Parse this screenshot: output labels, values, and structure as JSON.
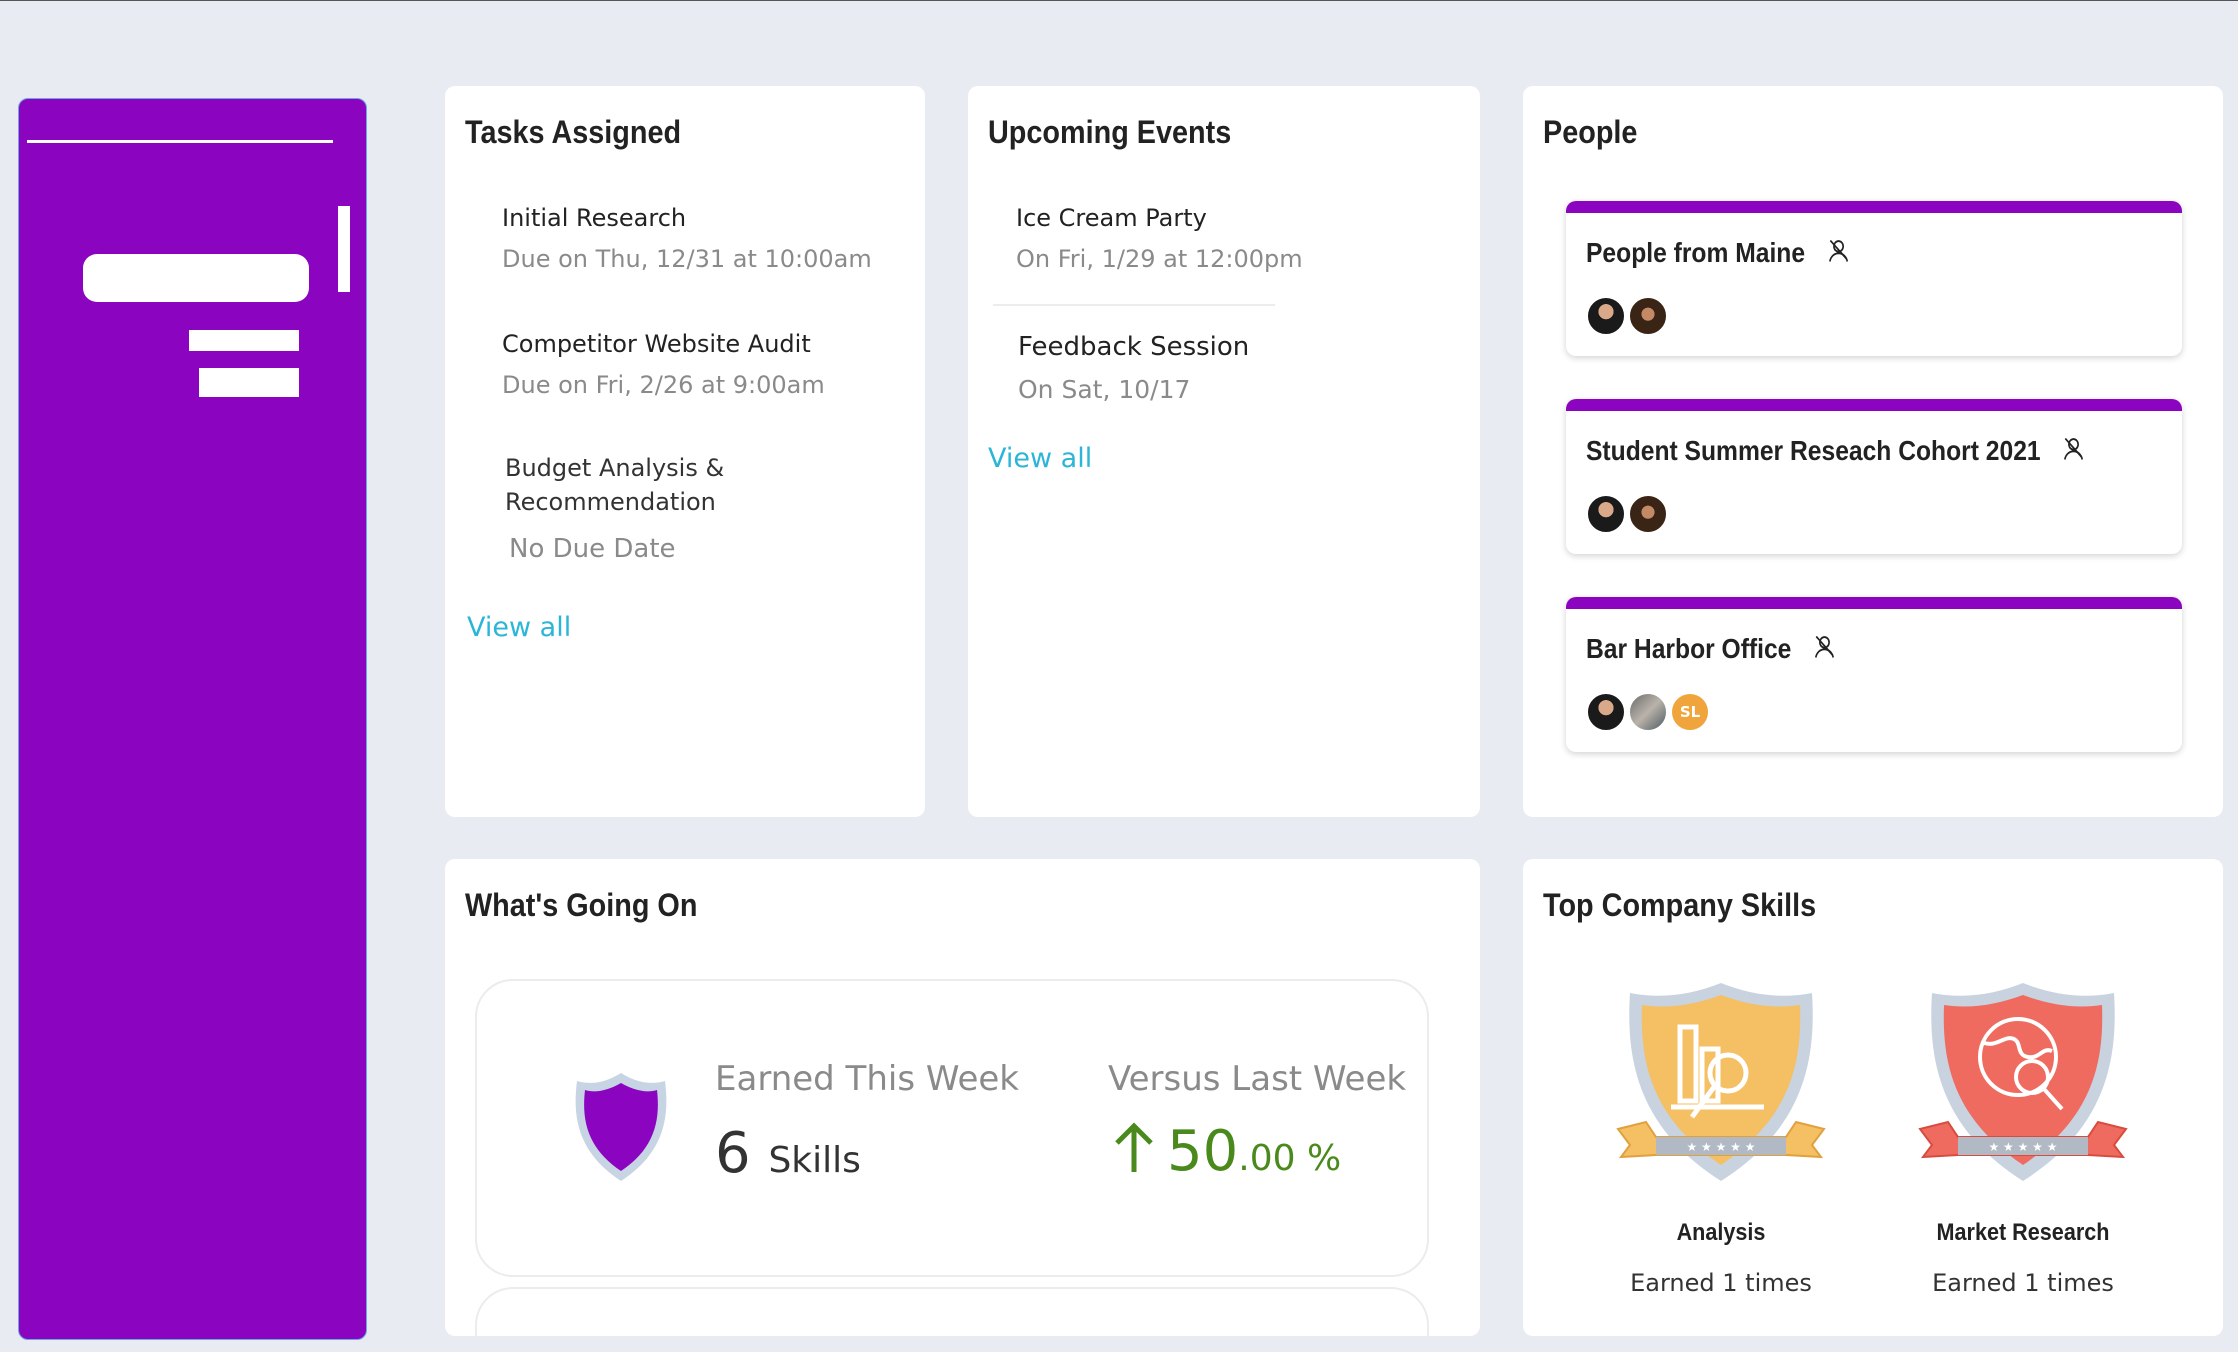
{
  "tasks": {
    "title": "Tasks Assigned",
    "items": [
      {
        "name": "Initial Research",
        "due": "Due on Thu, 12/31 at 10:00am"
      },
      {
        "name": "Competitor Website Audit",
        "due": "Due on Fri, 2/26 at 9:00am"
      },
      {
        "name_line1": "Budget Analysis &",
        "name_line2": "Recommendation",
        "due": "No Due Date"
      }
    ],
    "view_all": "View all"
  },
  "events": {
    "title": "Upcoming Events",
    "items": [
      {
        "name": "Ice Cream Party",
        "when": "On Fri, 1/29 at 12:00pm"
      },
      {
        "name": "Feedback Session",
        "when": "On Sat, 10/17"
      }
    ],
    "view_all": "View all"
  },
  "people": {
    "title": "People",
    "groups": [
      {
        "name": "People from Maine"
      },
      {
        "name": "Student Summer Reseach Cohort 2021"
      },
      {
        "name": "Bar Harbor Office",
        "initials": "SL"
      }
    ]
  },
  "whats_going_on": {
    "title": "What's Going On",
    "earned_label": "Earned This Week",
    "earned_value": "6",
    "earned_unit": "Skills",
    "versus_label": "Versus Last Week",
    "versus_value": "50",
    "versus_decimal": ".00 %"
  },
  "skills": {
    "title": "Top Company Skills",
    "items": [
      {
        "name": "Analysis",
        "earned": "Earned 1 times",
        "color": "#f5bf63"
      },
      {
        "name": "Market Research",
        "earned": "Earned 1 times",
        "color": "#ef6b5f"
      }
    ]
  },
  "colors": {
    "accent": "#8b05c0",
    "link": "#2bb5d6",
    "positive": "#4a8a1c"
  }
}
